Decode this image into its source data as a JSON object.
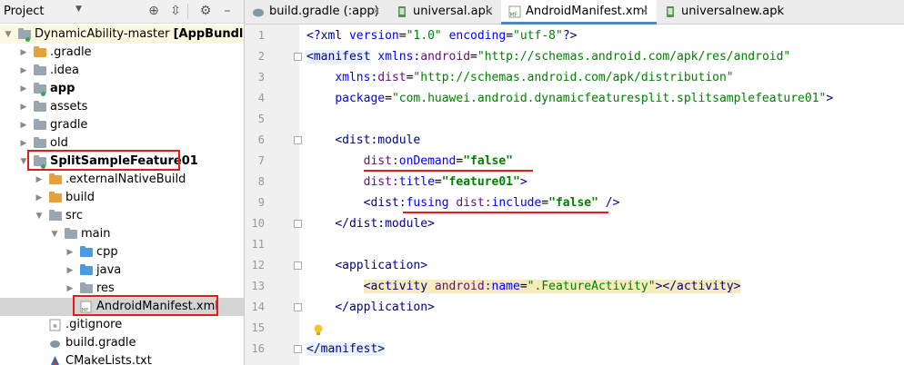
{
  "project_panel": {
    "title": "Project",
    "header_icons": [
      "target-icon",
      "collapse-icon",
      "gear-icon",
      "hide-icon"
    ],
    "tree": [
      {
        "label": "DynamicAbility-master",
        "suffix": "[AppBundleDem",
        "icon": "module-folder",
        "depth": 0,
        "expanded": true
      },
      {
        "label": ".gradle",
        "icon": "folder-orange",
        "depth": 1,
        "expanded": false
      },
      {
        "label": ".idea",
        "icon": "folder-gray",
        "depth": 1,
        "expanded": false
      },
      {
        "label": "app",
        "icon": "module-folder",
        "depth": 1,
        "expanded": false,
        "bold": true
      },
      {
        "label": "assets",
        "icon": "folder-gray",
        "depth": 1,
        "expanded": false
      },
      {
        "label": "gradle",
        "icon": "folder-gray",
        "depth": 1,
        "expanded": false
      },
      {
        "label": "old",
        "icon": "folder-gray",
        "depth": 1,
        "expanded": false
      },
      {
        "label": "SplitSampleFeature01",
        "icon": "module-folder",
        "depth": 1,
        "expanded": true,
        "bold": true
      },
      {
        "label": ".externalNativeBuild",
        "icon": "folder-orange",
        "depth": 2,
        "expanded": false
      },
      {
        "label": "build",
        "icon": "folder-orange",
        "depth": 2,
        "expanded": false
      },
      {
        "label": "src",
        "icon": "folder-gray",
        "depth": 2,
        "expanded": true
      },
      {
        "label": "main",
        "icon": "folder-gray",
        "depth": 3,
        "expanded": true
      },
      {
        "label": "cpp",
        "icon": "folder-blue",
        "depth": 4,
        "expanded": false
      },
      {
        "label": "java",
        "icon": "folder-blue",
        "depth": 4,
        "expanded": false
      },
      {
        "label": "res",
        "icon": "folder-res",
        "depth": 4,
        "expanded": false
      },
      {
        "label": "AndroidManifest.xml",
        "icon": "manifest-file",
        "depth": 4,
        "selected": true
      },
      {
        "label": ".gitignore",
        "icon": "gitignore-file",
        "depth": 2
      },
      {
        "label": "build.gradle",
        "icon": "gradle-file",
        "depth": 2
      },
      {
        "label": "CMakeLists.txt",
        "icon": "cmake-file",
        "depth": 2
      }
    ]
  },
  "tabs": [
    {
      "label": "build.gradle (:app)",
      "icon": "gradle-icon",
      "active": false
    },
    {
      "label": "universal.apk",
      "icon": "apk-icon",
      "active": false
    },
    {
      "label": "AndroidManifest.xml",
      "icon": "manifest-icon",
      "active": true
    },
    {
      "label": "universalnew.apk",
      "icon": "apk-icon",
      "active": false
    }
  ],
  "editor": {
    "line_numbers": [
      "1",
      "2",
      "3",
      "4",
      "5",
      "6",
      "7",
      "8",
      "9",
      "10",
      "11",
      "12",
      "13",
      "14",
      "15",
      "16"
    ],
    "lines": [
      [
        {
          "c": "tag",
          "t": "<?"
        },
        {
          "c": "tag",
          "t": "xml "
        },
        {
          "c": "attr",
          "t": "version"
        },
        {
          "c": "txt",
          "t": "="
        },
        {
          "c": "val",
          "t": "\"1.0\""
        },
        {
          "c": "txt",
          "t": " "
        },
        {
          "c": "attr",
          "t": "encoding"
        },
        {
          "c": "txt",
          "t": "="
        },
        {
          "c": "val",
          "t": "\"utf-8\""
        },
        {
          "c": "tag",
          "t": "?>"
        }
      ],
      [
        {
          "c": "tag hl-tag",
          "t": "<manifest"
        },
        {
          "c": "txt",
          "t": " "
        },
        {
          "c": "attr",
          "t": "xmlns:"
        },
        {
          "c": "ns",
          "t": "android"
        },
        {
          "c": "txt",
          "t": "="
        },
        {
          "c": "val",
          "t": "\"http://schemas.android.com/apk/res/android\""
        }
      ],
      [
        {
          "c": "txt",
          "t": "    "
        },
        {
          "c": "attr",
          "t": "xmlns:"
        },
        {
          "c": "ns",
          "t": "dist"
        },
        {
          "c": "txt",
          "t": "="
        },
        {
          "c": "val",
          "t": "\"http://schemas.android.com/apk/distribution\""
        }
      ],
      [
        {
          "c": "txt",
          "t": "    "
        },
        {
          "c": "attr",
          "t": "package"
        },
        {
          "c": "txt",
          "t": "="
        },
        {
          "c": "val",
          "t": "\"com.huawei.android.dynamicfeaturesplit.splitsamplefeature01\""
        },
        {
          "c": "tag",
          "t": ">"
        }
      ],
      [],
      [
        {
          "c": "txt",
          "t": "    "
        },
        {
          "c": "tag",
          "t": "<dist:module"
        }
      ],
      [
        {
          "c": "txt",
          "t": "        "
        },
        {
          "c": "ns",
          "t": "dist:"
        },
        {
          "c": "attr",
          "t": "onDemand"
        },
        {
          "c": "txt",
          "t": "="
        },
        {
          "c": "valb",
          "t": "\"false\""
        }
      ],
      [
        {
          "c": "txt",
          "t": "        "
        },
        {
          "c": "ns",
          "t": "dist:"
        },
        {
          "c": "attr",
          "t": "title"
        },
        {
          "c": "txt",
          "t": "="
        },
        {
          "c": "valb",
          "t": "\"feature01\""
        },
        {
          "c": "tag",
          "t": ">"
        }
      ],
      [
        {
          "c": "txt",
          "t": "        "
        },
        {
          "c": "tag",
          "t": "<dist:"
        },
        {
          "c": "attr",
          "t": "fusing "
        },
        {
          "c": "ns",
          "t": "dist:"
        },
        {
          "c": "attr",
          "t": "include"
        },
        {
          "c": "txt",
          "t": "="
        },
        {
          "c": "valb",
          "t": "\"false\""
        },
        {
          "c": "txt",
          "t": " "
        },
        {
          "c": "tag",
          "t": "/>"
        }
      ],
      [
        {
          "c": "txt",
          "t": "    "
        },
        {
          "c": "tag",
          "t": "</dist:module>"
        }
      ],
      [],
      [
        {
          "c": "txt",
          "t": "    "
        },
        {
          "c": "tag",
          "t": "<application"
        },
        {
          "c": "tag",
          "t": ">"
        }
      ],
      [
        {
          "c": "txt",
          "t": "        "
        },
        {
          "c": "tag hl-yellow",
          "t": "<activity "
        },
        {
          "c": "ns hl-yellow",
          "t": "android:"
        },
        {
          "c": "attr hl-yellow",
          "t": "name"
        },
        {
          "c": "txt hl-yellow",
          "t": "="
        },
        {
          "c": "val hl-yellow",
          "t": "\".FeatureActivity\""
        },
        {
          "c": "tag hl-yellow",
          "t": "></activity>"
        }
      ],
      [
        {
          "c": "txt",
          "t": "    "
        },
        {
          "c": "tag",
          "t": "</application>"
        }
      ],
      [],
      [
        {
          "c": "tag hl-tag",
          "t": "</manifest>"
        }
      ]
    ]
  }
}
